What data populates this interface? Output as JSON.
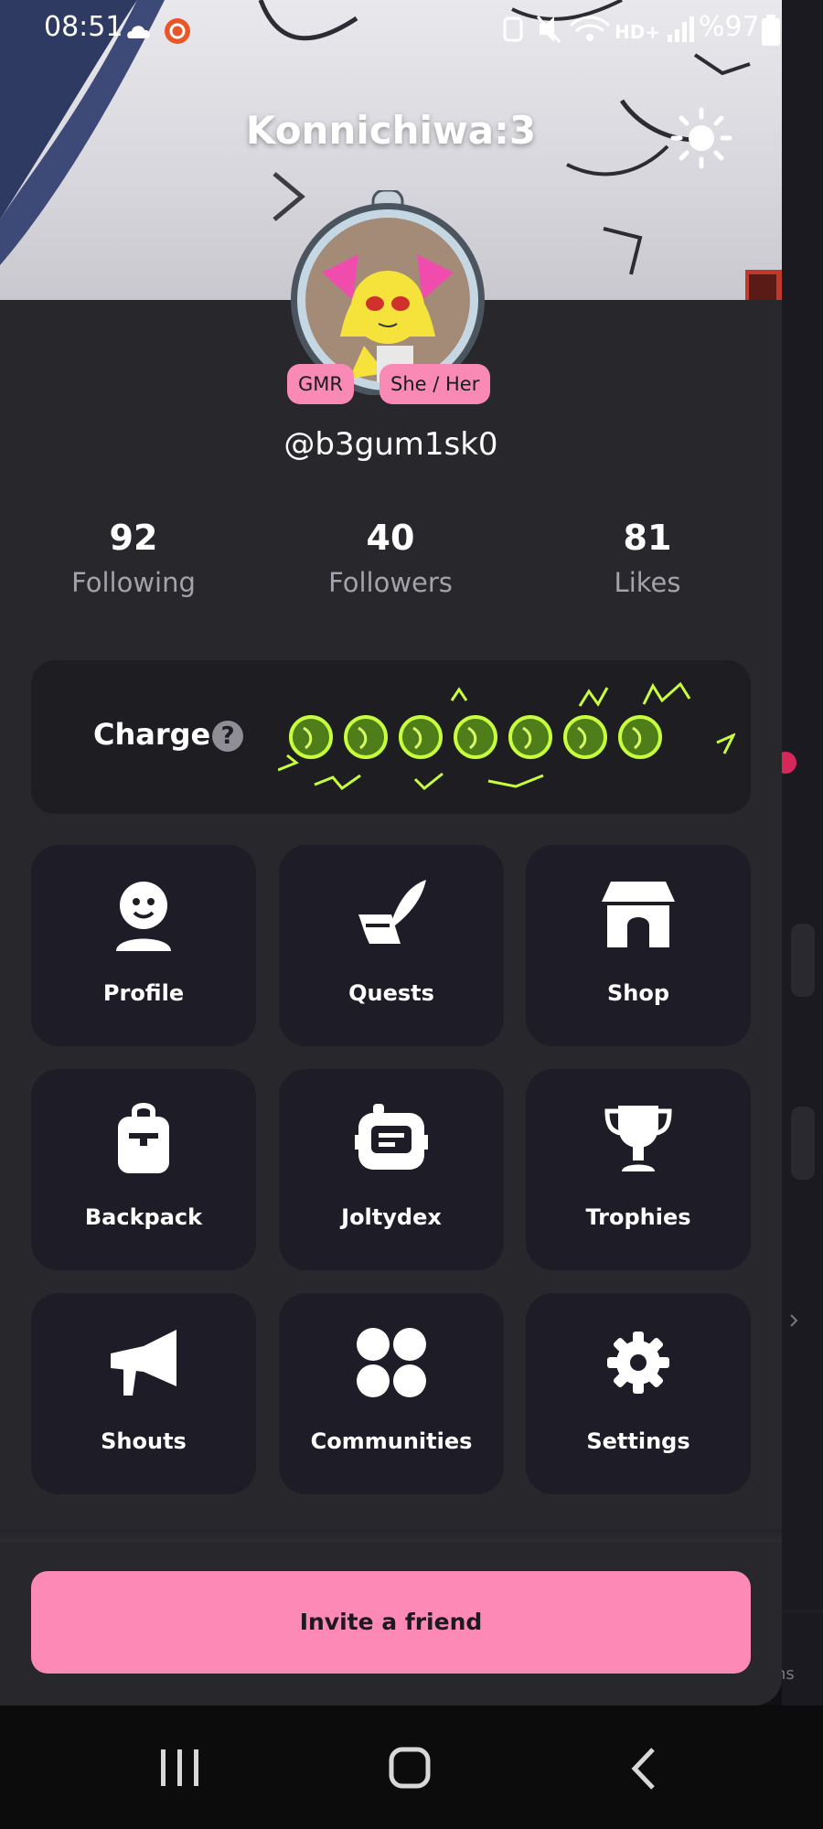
{
  "status_bar": {
    "time": "08:51",
    "battery_percent": "%97"
  },
  "header": {
    "title": "Konnichiwa:3",
    "theme_icon": "sun-icon"
  },
  "profile": {
    "avatar": "avatar-image",
    "tags": [
      "GMR",
      "She / Her"
    ],
    "handle": "@b3gum1sk0"
  },
  "stats": [
    {
      "value": "92",
      "label": "Following"
    },
    {
      "value": "40",
      "label": "Followers"
    },
    {
      "value": "81",
      "label": "Likes"
    }
  ],
  "charge": {
    "label": "Charge",
    "help_symbol": "?",
    "orb_count": 7
  },
  "menu": [
    {
      "label": "Profile",
      "icon": "profile-icon"
    },
    {
      "label": "Quests",
      "icon": "quests-icon"
    },
    {
      "label": "Shop",
      "icon": "shop-icon"
    },
    {
      "label": "Backpack",
      "icon": "backpack-icon"
    },
    {
      "label": "Joltydex",
      "icon": "joltydex-icon"
    },
    {
      "label": "Trophies",
      "icon": "trophy-icon"
    },
    {
      "label": "Shouts",
      "icon": "megaphone-icon"
    },
    {
      "label": "Communities",
      "icon": "communities-icon"
    },
    {
      "label": "Settings",
      "icon": "gear-icon"
    }
  ],
  "invite_button": "Invite a friend",
  "background_peek_text": "ns",
  "colors": {
    "panel_bg": "#28272c",
    "tile_bg": "#1d1c27",
    "accent_pink": "#fd89b7",
    "muted_text": "#a4a2aa",
    "orb_green": "#7ed321"
  }
}
